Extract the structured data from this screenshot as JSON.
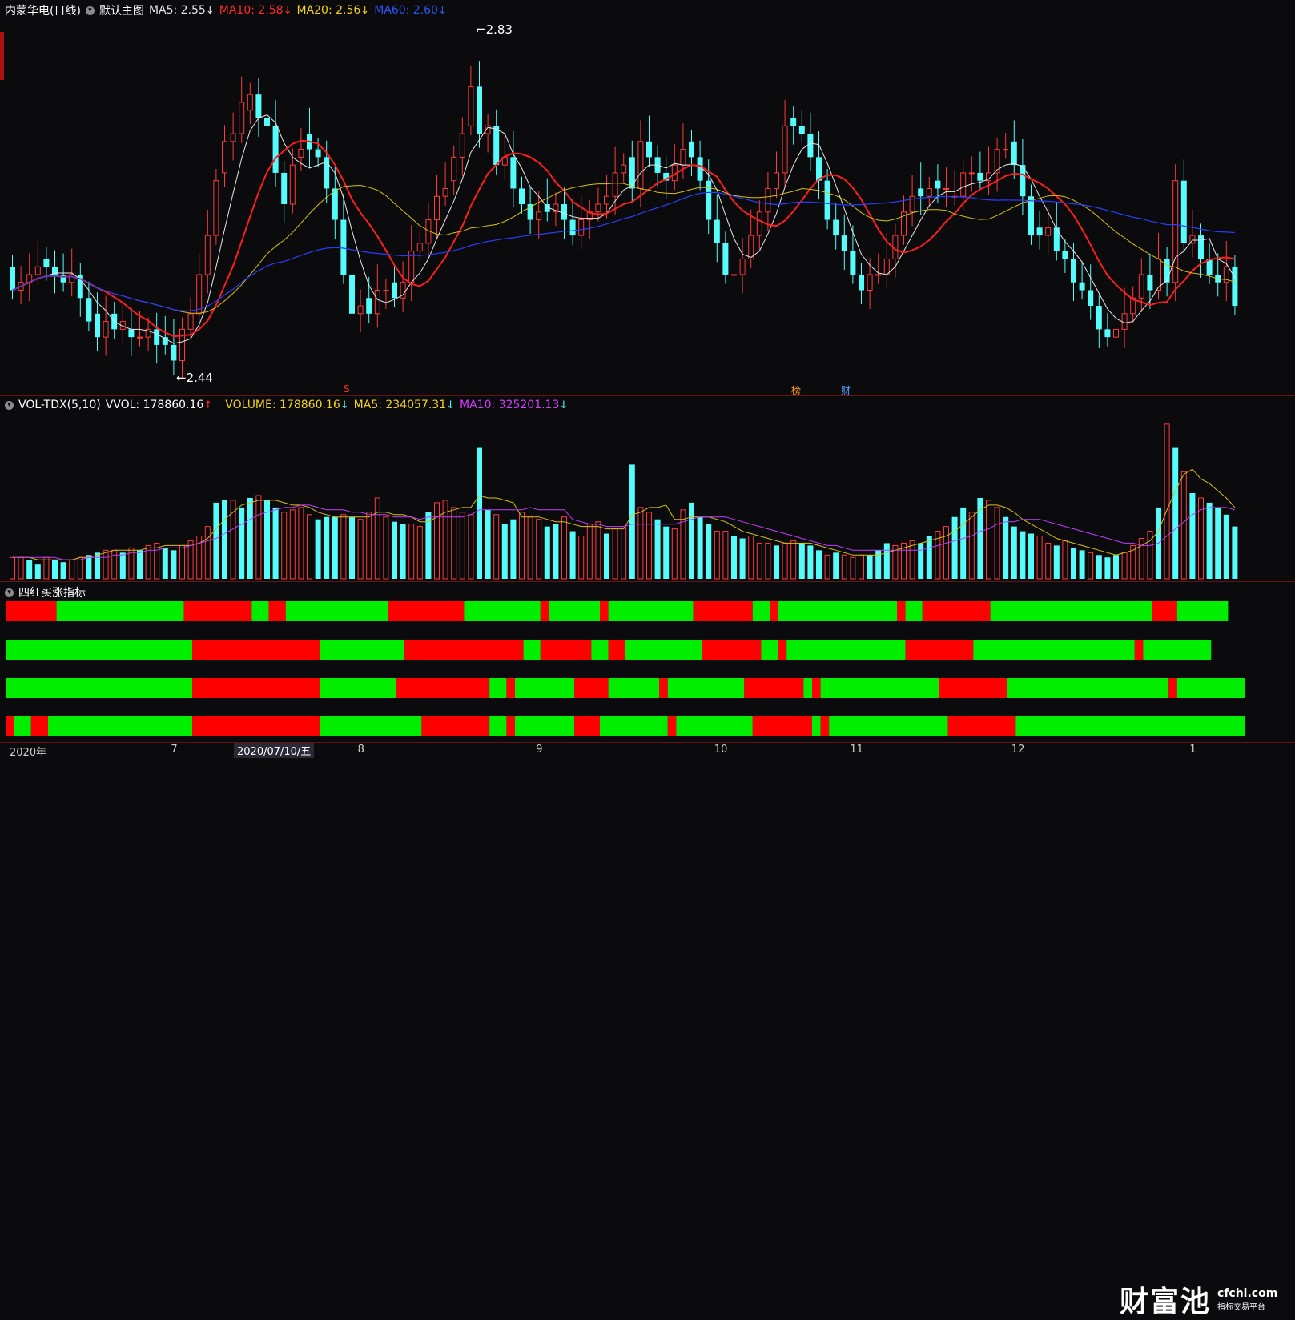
{
  "price_panel": {
    "stock": "内蒙华电(日线)",
    "template": "默认主图",
    "ma5": {
      "label": "MA5:",
      "value": "2.55",
      "arrow": "↓",
      "color": "#e8e8e8"
    },
    "ma10": {
      "label": "MA10:",
      "value": "2.58",
      "arrow": "↓",
      "color": "#ff2b2b"
    },
    "ma20": {
      "label": "MA20:",
      "value": "2.56",
      "arrow": "↓",
      "color": "#f2d21a"
    },
    "ma60": {
      "label": "MA60:",
      "value": "2.60",
      "arrow": "↓",
      "color": "#2a56ff"
    },
    "high_label": "2.83",
    "low_label": "2.44",
    "marker_s": "S",
    "marker_bang": "榜",
    "marker_cai": "财"
  },
  "volume_panel": {
    "name": "VOL-TDX(5,10)",
    "vvol": {
      "label": "VVOL:",
      "value": "178860.16",
      "arrow": "↑"
    },
    "volume": {
      "label": "VOLUME:",
      "value": "178860.16",
      "arrow": "↓"
    },
    "ma5": {
      "label": "MA5:",
      "value": "234057.31",
      "arrow": "↓"
    },
    "ma10": {
      "label": "MA10:",
      "value": "325201.13",
      "arrow": "↓"
    }
  },
  "indicator_panel": {
    "name": "四红买涨指标",
    "colors": {
      "red": "#ff0000",
      "green": "#00ee00"
    },
    "rows": [
      "RRRRRRGGGGGGGGGGGGGGGRRRRRRRRGGRRGGGGGGGGGGGGRRRRRRRRRGGGGGGGGGRGGGGGGRGGGGGGGGGGRRRRRRRGGRGGGGGGGGGGGGGGRGGRRRRRRRRGGGGGGGGGGGGGGGGGGGRRRGGGGGG",
      "GGGGGGGGGGGGGGGGGGGGGGRRRRRRRRRRRRRRRGGGGGGGGGGRRRRRRRRRRRRRRGGRRRRRRGGRRGGGGGGGGGRRRRRRRGGRGGGGGGGGGGGGGGRRRRRRRRGGGGGGGGGGGGGGGGGGGRGGGGGGGG",
      "GGGGGGGGGGGGGGGGGGGGGGRRRRRRRRRRRRRRRGGGGGGGGGRRRRRRRRRRRGGRGGGGGGGRRRRGGGGGGRGGGGGGGGGRRRRRRRGRGGGGGGGGGGGGGGRRRRRRRRGGGGGGGGGGGGGGGGGGGRGGGGGGGG",
      "RGGRRGGGGGGGGGGGGGGGGGRRRRRRRRRRRRRRRGGGGGGGGGGGGRRRRRRRRGGRGGGGGGGRRRGGGGGGGGRGGGGGGGGGRRRRRRRGRGGGGGGGGGGGGGGRRRRRRRRGGGGGGGGGGGGGGGGGGGGGGGGGGG"
    ]
  },
  "x_axis": {
    "labels": [
      {
        "text": "2020年",
        "bar": 0
      },
      {
        "text": "7",
        "bar": 19
      },
      {
        "text": "8",
        "bar": 41
      },
      {
        "text": "9",
        "bar": 62
      },
      {
        "text": "10",
        "bar": 83
      },
      {
        "text": "11",
        "bar": 99
      },
      {
        "text": "12",
        "bar": 118
      },
      {
        "text": "1",
        "bar": 139
      }
    ],
    "cursor_date": "2020/07/10/五"
  },
  "logo": {
    "main": "财富池",
    "url": "cfchi.com",
    "sub": "指标交易平台"
  },
  "chart_data": {
    "type": "candlestick",
    "close": [
      2.53,
      2.54,
      2.55,
      2.56,
      2.56,
      2.55,
      2.54,
      2.55,
      2.52,
      2.49,
      2.47,
      2.49,
      2.48,
      2.49,
      2.47,
      2.47,
      2.48,
      2.46,
      2.46,
      2.44,
      2.48,
      2.5,
      2.55,
      2.6,
      2.67,
      2.72,
      2.73,
      2.77,
      2.78,
      2.75,
      2.74,
      2.68,
      2.64,
      2.69,
      2.71,
      2.71,
      2.7,
      2.66,
      2.62,
      2.55,
      2.5,
      2.51,
      2.5,
      2.53,
      2.53,
      2.52,
      2.54,
      2.58,
      2.59,
      2.62,
      2.65,
      2.66,
      2.7,
      2.73,
      2.79,
      2.73,
      2.74,
      2.69,
      2.7,
      2.66,
      2.64,
      2.62,
      2.63,
      2.63,
      2.64,
      2.62,
      2.6,
      2.62,
      2.63,
      2.64,
      2.65,
      2.68,
      2.69,
      2.66,
      2.72,
      2.7,
      2.68,
      2.67,
      2.69,
      2.71,
      2.7,
      2.67,
      2.62,
      2.59,
      2.55,
      2.55,
      2.57,
      2.6,
      2.63,
      2.66,
      2.68,
      2.74,
      2.74,
      2.73,
      2.7,
      2.67,
      2.62,
      2.6,
      2.58,
      2.55,
      2.53,
      2.55,
      2.55,
      2.57,
      2.6,
      2.63,
      2.65,
      2.65,
      2.66,
      2.66,
      2.66,
      2.65,
      2.68,
      2.68,
      2.67,
      2.68,
      2.71,
      2.71,
      2.69,
      2.65,
      2.6,
      2.6,
      2.61,
      2.58,
      2.57,
      2.54,
      2.53,
      2.51,
      2.48,
      2.47,
      2.48,
      2.5,
      2.52,
      2.55,
      2.53,
      2.57,
      2.54,
      2.67,
      2.59,
      2.6,
      2.57,
      2.55,
      2.54,
      2.56,
      2.51
    ],
    "open": [
      2.56,
      2.53,
      2.54,
      2.55,
      2.57,
      2.56,
      2.55,
      2.54,
      2.55,
      2.52,
      2.5,
      2.47,
      2.5,
      2.48,
      2.48,
      2.47,
      2.47,
      2.48,
      2.47,
      2.46,
      2.44,
      2.48,
      2.5,
      2.55,
      2.6,
      2.68,
      2.72,
      2.73,
      2.76,
      2.78,
      2.75,
      2.74,
      2.68,
      2.64,
      2.7,
      2.73,
      2.71,
      2.7,
      2.66,
      2.62,
      2.55,
      2.5,
      2.52,
      2.5,
      2.53,
      2.54,
      2.52,
      2.54,
      2.58,
      2.59,
      2.62,
      2.65,
      2.67,
      2.7,
      2.74,
      2.79,
      2.73,
      2.74,
      2.69,
      2.7,
      2.66,
      2.64,
      2.62,
      2.64,
      2.63,
      2.64,
      2.62,
      2.6,
      2.62,
      2.63,
      2.64,
      2.65,
      2.68,
      2.7,
      2.66,
      2.72,
      2.7,
      2.68,
      2.67,
      2.69,
      2.72,
      2.7,
      2.67,
      2.62,
      2.59,
      2.55,
      2.55,
      2.57,
      2.6,
      2.63,
      2.66,
      2.68,
      2.75,
      2.74,
      2.73,
      2.7,
      2.67,
      2.62,
      2.6,
      2.58,
      2.55,
      2.53,
      2.55,
      2.55,
      2.57,
      2.6,
      2.63,
      2.66,
      2.65,
      2.67,
      2.66,
      2.65,
      2.65,
      2.68,
      2.68,
      2.67,
      2.68,
      2.71,
      2.72,
      2.69,
      2.65,
      2.61,
      2.6,
      2.61,
      2.58,
      2.57,
      2.54,
      2.53,
      2.51,
      2.48,
      2.47,
      2.48,
      2.5,
      2.52,
      2.55,
      2.53,
      2.57,
      2.54,
      2.67,
      2.59,
      2.6,
      2.57,
      2.55,
      2.54,
      2.56
    ],
    "volume_red": [
      1,
      1,
      0,
      0,
      1,
      0,
      0,
      1,
      1,
      0,
      0,
      1,
      1,
      0,
      1,
      0,
      1,
      1,
      0,
      0,
      1,
      1,
      1,
      1,
      0,
      0,
      1,
      0,
      0,
      1,
      0,
      0,
      1,
      1,
      1,
      1,
      0,
      0,
      0,
      1,
      0,
      1,
      1,
      1,
      1,
      0,
      0,
      1,
      1,
      0,
      1,
      1,
      1,
      1,
      1,
      0,
      0,
      1,
      0,
      0,
      1,
      1,
      1,
      0,
      0,
      1,
      0,
      1,
      1,
      1,
      0,
      1,
      1,
      0,
      1,
      1,
      0,
      0,
      1,
      1,
      0,
      0,
      0,
      1,
      1,
      0,
      0,
      1,
      1,
      1,
      0,
      1,
      1,
      0,
      0,
      0,
      1,
      0,
      1,
      1,
      1,
      0,
      0,
      0,
      1,
      1,
      1,
      0,
      0,
      1,
      1,
      0,
      0,
      1,
      0,
      1,
      1,
      0,
      0,
      0,
      0,
      1,
      1,
      0,
      1,
      0,
      0,
      1,
      0,
      0,
      0,
      1,
      1,
      1,
      1,
      0,
      1,
      0,
      1,
      0,
      1,
      0,
      0,
      0,
      0
    ],
    "volume": [
      9,
      9,
      8,
      6,
      9,
      8,
      7,
      8,
      9,
      10,
      11,
      12,
      12,
      11,
      13,
      12,
      14,
      15,
      13,
      12,
      14,
      16,
      18,
      22,
      32,
      33,
      33,
      30,
      34,
      35,
      33,
      30,
      28,
      29,
      30,
      27,
      25,
      26,
      26,
      27,
      26,
      25,
      28,
      34,
      26,
      24,
      23,
      23,
      22,
      28,
      32,
      33,
      30,
      28,
      27,
      55,
      29,
      27,
      23,
      25,
      28,
      26,
      25,
      22,
      23,
      26,
      20,
      18,
      23,
      24,
      19,
      21,
      22,
      48,
      30,
      28,
      25,
      22,
      21,
      29,
      32,
      26,
      23,
      20,
      20,
      18,
      17,
      18,
      15,
      15,
      14,
      15,
      16,
      15,
      14,
      12,
      10,
      11,
      10,
      9,
      10,
      10,
      12,
      15,
      14,
      15,
      16,
      15,
      18,
      20,
      22,
      26,
      30,
      28,
      34,
      33,
      30,
      26,
      22,
      20,
      19,
      18,
      15,
      14,
      16,
      13,
      12,
      11,
      10,
      9,
      10,
      11,
      14,
      17,
      20,
      30,
      65,
      55,
      45,
      36,
      34,
      32,
      30,
      27,
      22
    ],
    "ma5_vol": [
      9,
      9,
      9,
      8,
      8,
      8,
      8,
      8,
      9,
      9,
      10,
      11,
      12,
      12,
      12,
      12,
      13,
      13,
      14,
      14,
      14,
      14,
      15,
      17,
      21,
      25,
      28,
      31,
      32,
      33,
      33,
      33,
      32,
      31,
      31,
      30,
      28,
      27,
      26,
      26,
      26,
      26,
      26,
      28,
      28,
      27,
      27,
      26,
      24,
      24,
      26,
      28,
      29,
      30,
      30,
      35,
      34,
      34,
      33,
      32,
      26,
      26,
      26,
      25,
      24,
      24,
      23,
      22,
      22,
      22,
      21,
      21,
      21,
      27,
      28,
      30,
      30,
      31,
      25,
      25,
      26,
      26,
      26,
      25,
      24,
      22,
      20,
      19,
      18,
      17,
      16,
      15,
      15,
      15,
      15,
      14,
      13,
      12,
      11,
      10,
      10,
      10,
      10,
      11,
      12,
      13,
      14,
      15,
      16,
      17,
      18,
      20,
      23,
      26,
      29,
      31,
      31,
      30,
      28,
      25,
      23,
      21,
      19,
      17,
      16,
      15,
      14,
      13,
      12,
      11,
      10,
      11,
      12,
      14,
      16,
      20,
      29,
      37,
      44,
      46,
      42,
      40,
      37,
      34,
      30
    ],
    "ma10_vol": [
      9,
      9,
      9,
      9,
      9,
      9,
      8,
      8,
      8,
      9,
      9,
      9,
      10,
      10,
      11,
      11,
      12,
      12,
      13,
      13,
      13,
      14,
      15,
      16,
      17,
      19,
      21,
      23,
      25,
      27,
      28,
      29,
      30,
      30,
      31,
      31,
      30,
      29,
      29,
      29,
      28,
      28,
      27,
      27,
      27,
      26,
      26,
      26,
      25,
      26,
      26,
      26,
      26,
      26,
      27,
      29,
      29,
      29,
      29,
      29,
      29,
      30,
      29,
      29,
      29,
      29,
      25,
      24,
      23,
      23,
      22,
      22,
      22,
      23,
      23,
      23,
      23,
      23,
      23,
      24,
      25,
      26,
      26,
      26,
      26,
      25,
      24,
      23,
      22,
      21,
      20,
      19,
      18,
      17,
      16,
      15,
      14,
      14,
      13,
      12,
      12,
      12,
      12,
      12,
      12,
      12,
      12,
      12,
      13,
      14,
      15,
      16,
      17,
      18,
      20,
      21,
      23,
      24,
      24,
      25,
      25,
      25,
      24,
      23,
      22,
      21,
      20,
      19,
      18,
      17,
      16,
      15,
      15,
      14,
      14,
      15,
      18,
      21,
      24,
      27,
      29,
      30,
      30,
      30,
      29
    ]
  }
}
